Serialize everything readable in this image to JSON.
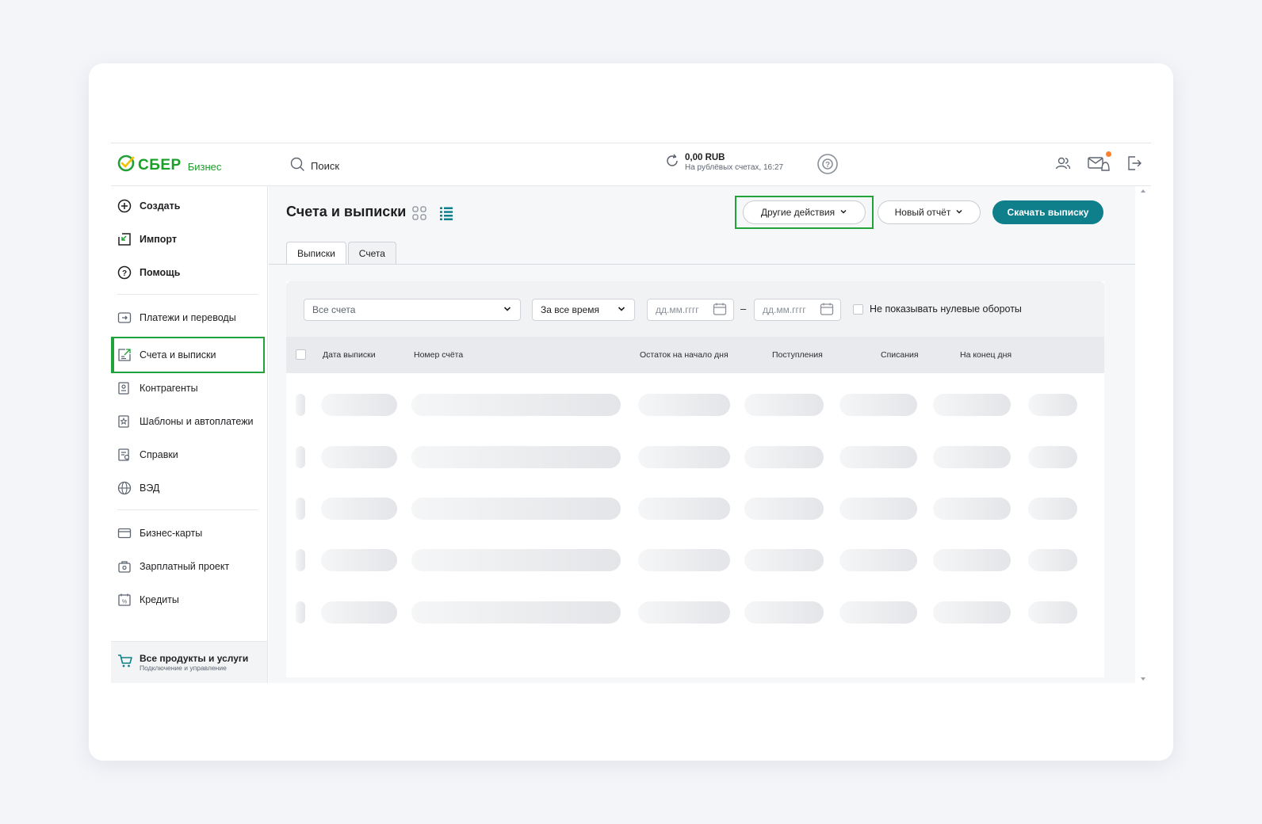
{
  "header": {
    "logo_text": "СБЕР",
    "logo_sub": "Бизнес",
    "search_placeholder": "Поиск",
    "balance_amount": "0,00 RUB",
    "balance_sub": "На рублёвых счетах, 16:27"
  },
  "sidebar": {
    "items": [
      {
        "label": "Создать",
        "icon": "plus-circle-icon"
      },
      {
        "label": "Импорт",
        "icon": "import-icon"
      },
      {
        "label": "Помощь",
        "icon": "help-circle-icon"
      },
      {
        "label": "Платежи и переводы",
        "icon": "payments-icon"
      },
      {
        "label": "Счета и выписки",
        "icon": "accounts-icon",
        "active": true
      },
      {
        "label": "Контрагенты",
        "icon": "contractors-icon"
      },
      {
        "label": "Шаблоны и автоплатежи",
        "icon": "templates-icon"
      },
      {
        "label": "Справки",
        "icon": "certificates-icon"
      },
      {
        "label": "ВЭД",
        "icon": "globe-icon"
      },
      {
        "label": "Бизнес-карты",
        "icon": "card-icon"
      },
      {
        "label": "Зарплатный проект",
        "icon": "salary-icon"
      },
      {
        "label": "Кредиты",
        "icon": "credit-icon"
      }
    ],
    "bottom": {
      "title": "Все продукты и услуги",
      "subtitle": "Подключение и управление"
    }
  },
  "main": {
    "title": "Счета и выписки",
    "other_actions": "Другие действия",
    "new_report": "Новый отчёт",
    "download": "Скачать выписку",
    "tabs": [
      {
        "label": "Выписки",
        "active": true
      },
      {
        "label": "Счета",
        "active": false
      }
    ],
    "filters": {
      "accounts": "Все счета",
      "period": "За все время",
      "date_from_placeholder": "дд.мм.гггг",
      "date_to_placeholder": "дд.мм.гггг",
      "dash": "–",
      "hide_zero": "Не показывать нулевые обороты"
    },
    "columns": [
      "Дата выписки",
      "Номер счёта",
      "Остаток на начало дня",
      "Поступления",
      "Списания",
      "На конец дня"
    ]
  },
  "colors": {
    "brand_green": "#1a9f29",
    "primary_teal": "#107f8c",
    "highlight_green": "#1fa33a"
  }
}
